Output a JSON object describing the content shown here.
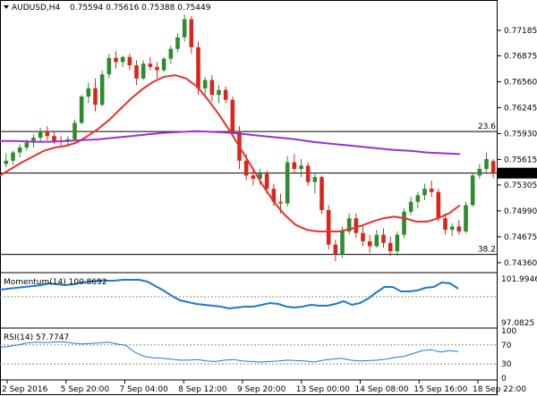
{
  "header": {
    "symbol": "AUDUSD,H4",
    "ohlc": "0.75594 0.75616 0.75388 0.75449",
    "arrow": "down-triangle-icon"
  },
  "colors": {
    "bull": "#2e8b2e",
    "bear": "#d8261d",
    "ma_short": "#e8302a",
    "ma_long": "#9933cc",
    "indicator": "#1f78d0",
    "level": "#000000",
    "grid_dash": "#888888"
  },
  "main": {
    "price_labels": [
      "0.77185",
      "0.76875",
      "0.76560",
      "0.76245",
      "0.75930",
      "0.75615",
      "0.75305",
      "0.74990",
      "0.74675",
      "0.74360"
    ],
    "price_values": [
      0.77185,
      0.76875,
      0.7656,
      0.76245,
      0.7593,
      0.75615,
      0.75305,
      0.7499,
      0.74675,
      0.7436
    ],
    "ylim": [
      0.7425,
      0.7738
    ],
    "levels": [
      {
        "label": "23.6",
        "value": 0.75955
      },
      {
        "label": "38.2",
        "value": 0.7446
      }
    ],
    "current_price": {
      "label": "0.75449",
      "value": 0.75449
    }
  },
  "momentum": {
    "title": "Momentum(14) 100.8692",
    "scale": [
      "101.9946",
      "97.0825"
    ],
    "scale_values": [
      101.9946,
      97.0825
    ],
    "ref_value": 100,
    "ylim": [
      96.8,
      102.4
    ]
  },
  "rsi": {
    "title": "RSI(14) 57.7747",
    "scale": [
      "100",
      "70",
      "30",
      "0"
    ],
    "scale_values": [
      100,
      70,
      30,
      0
    ],
    "ylim": [
      0,
      100
    ]
  },
  "time_axis": [
    "2 Sep 2016",
    "5 Sep 20:00",
    "7 Sep 04:00",
    "8 Sep 12:00",
    "9 Sep 20:00",
    "13 Sep 00:00",
    "14 Sep 08:00",
    "15 Sep 16:00",
    "18 Sep 22:00"
  ],
  "chart_data": {
    "type": "candlestick",
    "candles": [
      [
        0.7556,
        0.7569,
        0.7552,
        0.756
      ],
      [
        0.756,
        0.7572,
        0.7555,
        0.757
      ],
      [
        0.757,
        0.758,
        0.7564,
        0.7576
      ],
      [
        0.7576,
        0.7586,
        0.7572,
        0.7582
      ],
      [
        0.7582,
        0.7592,
        0.7576,
        0.7588
      ],
      [
        0.7588,
        0.76,
        0.7583,
        0.7596
      ],
      [
        0.7596,
        0.7602,
        0.7585,
        0.759
      ],
      [
        0.759,
        0.7596,
        0.758,
        0.7584
      ],
      [
        0.7584,
        0.759,
        0.7578,
        0.7583
      ],
      [
        0.7583,
        0.759,
        0.7577,
        0.7586
      ],
      [
        0.7586,
        0.761,
        0.7584,
        0.7606
      ],
      [
        0.7606,
        0.764,
        0.7604,
        0.7638
      ],
      [
        0.7638,
        0.7655,
        0.763,
        0.7648
      ],
      [
        0.7648,
        0.766,
        0.762,
        0.7628
      ],
      [
        0.7628,
        0.767,
        0.7626,
        0.7665
      ],
      [
        0.7665,
        0.769,
        0.766,
        0.7685
      ],
      [
        0.7685,
        0.7693,
        0.7672,
        0.768
      ],
      [
        0.768,
        0.7688,
        0.7674,
        0.7686
      ],
      [
        0.7686,
        0.769,
        0.767,
        0.7676
      ],
      [
        0.7676,
        0.7682,
        0.7652,
        0.766
      ],
      [
        0.766,
        0.7682,
        0.7658,
        0.7678
      ],
      [
        0.7678,
        0.7686,
        0.767,
        0.7674
      ],
      [
        0.7674,
        0.768,
        0.766,
        0.767
      ],
      [
        0.767,
        0.7686,
        0.7668,
        0.7684
      ],
      [
        0.7684,
        0.77,
        0.7678,
        0.7696
      ],
      [
        0.7696,
        0.7715,
        0.7692,
        0.771
      ],
      [
        0.771,
        0.7738,
        0.7705,
        0.7732
      ],
      [
        0.7732,
        0.7736,
        0.769,
        0.7698
      ],
      [
        0.7698,
        0.7705,
        0.764,
        0.7648
      ],
      [
        0.7648,
        0.7662,
        0.7638,
        0.7658
      ],
      [
        0.7658,
        0.7664,
        0.7632,
        0.764
      ],
      [
        0.764,
        0.7652,
        0.763,
        0.7646
      ],
      [
        0.7646,
        0.765,
        0.763,
        0.7634
      ],
      [
        0.7634,
        0.7638,
        0.759,
        0.7596
      ],
      [
        0.7596,
        0.7602,
        0.755,
        0.756
      ],
      [
        0.756,
        0.7568,
        0.7536,
        0.7542
      ],
      [
        0.7542,
        0.7548,
        0.753,
        0.7538
      ],
      [
        0.7538,
        0.755,
        0.753,
        0.7544
      ],
      [
        0.7544,
        0.7548,
        0.752,
        0.7526
      ],
      [
        0.7526,
        0.7532,
        0.7505,
        0.751
      ],
      [
        0.751,
        0.752,
        0.7496,
        0.7508
      ],
      [
        0.7508,
        0.7566,
        0.7504,
        0.7558
      ],
      [
        0.7558,
        0.7568,
        0.7544,
        0.755
      ],
      [
        0.755,
        0.7562,
        0.754,
        0.7554
      ],
      [
        0.7554,
        0.7558,
        0.753,
        0.7534
      ],
      [
        0.7534,
        0.7544,
        0.752,
        0.754
      ],
      [
        0.754,
        0.7542,
        0.7495,
        0.75
      ],
      [
        0.75,
        0.7506,
        0.7452,
        0.7458
      ],
      [
        0.7458,
        0.7464,
        0.7438,
        0.7446
      ],
      [
        0.7446,
        0.748,
        0.7442,
        0.7474
      ],
      [
        0.7474,
        0.7496,
        0.747,
        0.749
      ],
      [
        0.749,
        0.7496,
        0.7466,
        0.7472
      ],
      [
        0.7472,
        0.7482,
        0.7456,
        0.7462
      ],
      [
        0.7462,
        0.747,
        0.7448,
        0.7456
      ],
      [
        0.7456,
        0.7476,
        0.7454,
        0.747
      ],
      [
        0.747,
        0.7478,
        0.7454,
        0.746
      ],
      [
        0.746,
        0.7468,
        0.7444,
        0.745
      ],
      [
        0.745,
        0.7474,
        0.7444,
        0.747
      ],
      [
        0.747,
        0.7502,
        0.7466,
        0.7498
      ],
      [
        0.7498,
        0.7516,
        0.7494,
        0.751
      ],
      [
        0.751,
        0.7522,
        0.7502,
        0.7518
      ],
      [
        0.7518,
        0.7532,
        0.7512,
        0.7526
      ],
      [
        0.7526,
        0.7536,
        0.7516,
        0.7522
      ],
      [
        0.7522,
        0.7526,
        0.7486,
        0.749
      ],
      [
        0.749,
        0.7496,
        0.747,
        0.7476
      ],
      [
        0.7476,
        0.7484,
        0.7468,
        0.748
      ],
      [
        0.748,
        0.7488,
        0.747,
        0.7474
      ],
      [
        0.7474,
        0.751,
        0.7472,
        0.7506
      ],
      [
        0.7506,
        0.7546,
        0.7504,
        0.7542
      ],
      [
        0.7542,
        0.7556,
        0.7538,
        0.755
      ],
      [
        0.755,
        0.757,
        0.7546,
        0.7562
      ],
      [
        0.75594,
        0.75616,
        0.75388,
        0.75449
      ]
    ],
    "series": [
      {
        "values": [
          0.7542,
          0.755,
          0.7558,
          0.7565,
          0.7572,
          0.7576,
          0.7578,
          0.7582,
          0.759,
          0.7599,
          0.761,
          0.7623,
          0.7636,
          0.7647,
          0.7656,
          0.7662,
          0.7664,
          0.766,
          0.765,
          0.7634,
          0.7616,
          0.7596,
          0.7574,
          0.7552,
          0.753,
          0.751,
          0.7494,
          0.7482,
          0.7476,
          0.7474,
          0.7474,
          0.7474,
          0.7477,
          0.7481,
          0.7486,
          0.749,
          0.7492,
          0.749,
          0.7486,
          0.7486,
          0.749,
          0.7496,
          0.7506
        ]
      },
      {
        "values": [
          0.7584,
          0.7584,
          0.7583,
          0.7583,
          0.7584,
          0.7585,
          0.7586,
          0.7588,
          0.759,
          0.7592,
          0.7594,
          0.7595,
          0.7596,
          0.7595,
          0.7594,
          0.7592,
          0.759,
          0.7588,
          0.7586,
          0.7583,
          0.7581,
          0.7579,
          0.7577,
          0.7575,
          0.7573,
          0.7572,
          0.757,
          0.7569,
          0.7568
        ]
      }
    ],
    "momentum": [
      100.8,
      100.9,
      101.0,
      101.1,
      101.2,
      101.3,
      101.5,
      101.4,
      101.3,
      101.4,
      101.6,
      101.7,
      101.8,
      101.8,
      101.8,
      101.9,
      101.9,
      101.9,
      101.7,
      101.2,
      100.7,
      100.1,
      99.6,
      99.4,
      99.2,
      99.1,
      99.0,
      98.9,
      98.7,
      98.8,
      98.9,
      98.9,
      99.1,
      99.3,
      99.2,
      98.9,
      98.8,
      98.9,
      99.1,
      99.0,
      99.0,
      99.2,
      99.5,
      99.1,
      99.3,
      99.8,
      100.5,
      101.1,
      101.1,
      100.6,
      100.6,
      100.7,
      101.0,
      101.1,
      101.6,
      101.5,
      100.9
    ],
    "rsi": [
      65,
      67,
      70,
      74,
      76,
      75,
      76,
      77,
      74,
      72,
      73,
      74,
      76,
      72,
      69,
      55,
      46,
      43,
      42,
      40,
      38,
      38,
      39,
      36,
      35,
      38,
      39,
      36,
      35,
      34,
      35,
      36,
      38,
      37,
      36,
      34,
      38,
      40,
      42,
      38,
      36,
      37,
      38,
      40,
      44,
      46,
      52,
      58,
      60,
      55,
      58,
      56
    ],
    "ylim": [
      0.7425,
      0.7738
    ]
  }
}
